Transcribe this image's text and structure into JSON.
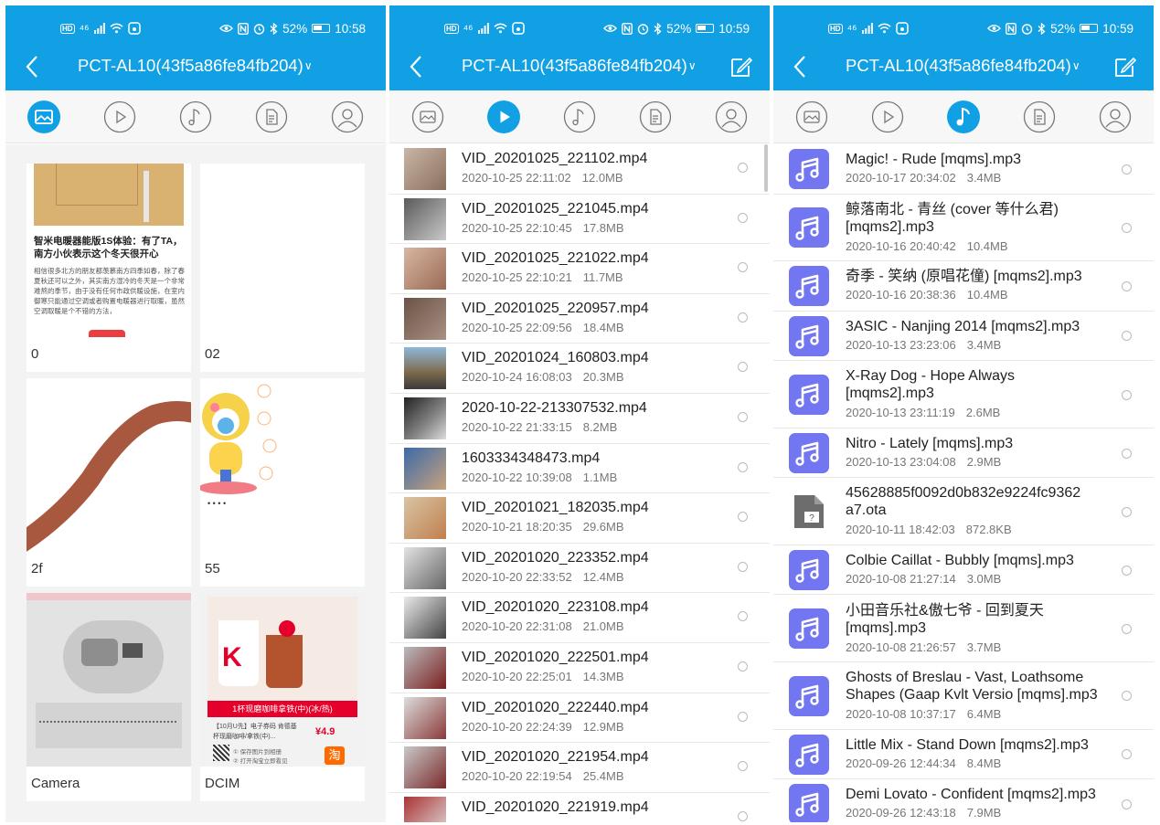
{
  "status_bars": [
    {
      "hd": "HD",
      "net": "⁴⁶",
      "battery": "52%",
      "time": "10:58"
    },
    {
      "hd": "HD",
      "net": "⁴⁶",
      "battery": "52%",
      "time": "10:59"
    },
    {
      "hd": "HD",
      "net": "⁴⁶",
      "battery": "52%",
      "time": "10:59"
    }
  ],
  "device_title": "PCT-AL10(43f5a86fe84fb204)",
  "tab_icons": [
    "picture-icon",
    "video-play-icon",
    "music-note-icon",
    "document-icon",
    "contact-person-icon"
  ],
  "accent_color": "#10a0e3",
  "music_icon_color": "#7276f0",
  "screen1": {
    "folders": [
      {
        "label": "0",
        "article_title": "智米电暖器能版1S体验：有了TA，南方小伙表示这个冬天很开心",
        "article_body": "相信很多北方的朋友都羡慕南方四季如春，除了春夏秋还可以之外，其实南方湿冷的冬天是一个非常难熬的季节，由于没有任何市政供暖设施，在室内御寒只能通过空调或者购置电暖器进行取暖，虽然空调取暖是个不错的方法，"
      },
      {
        "label": "02"
      },
      {
        "label": "2f"
      },
      {
        "label": "55"
      },
      {
        "label": "Camera"
      },
      {
        "label": "DCIM",
        "ad_headline": "1杯现磨咖啡拿铁(中)(冰/热)",
        "ad_price": "¥4.9",
        "ad_desc": "【10月U先】电子券码 肯德基 杯现磨咖啡/拿铁(中)...",
        "ad_step1": "① 保存图片到相册",
        "ad_step2": "② 打开淘宝立即看见",
        "ad_taobao": "淘",
        "ad_k": "K"
      }
    ]
  },
  "screen2": {
    "videos": [
      {
        "name": "VID_20201025_221102.mp4",
        "date": "2020-10-25 22:11:02",
        "size": "12.0MB"
      },
      {
        "name": "VID_20201025_221045.mp4",
        "date": "2020-10-25 22:10:45",
        "size": "17.8MB"
      },
      {
        "name": "VID_20201025_221022.mp4",
        "date": "2020-10-25 22:10:21",
        "size": "11.7MB"
      },
      {
        "name": "VID_20201025_220957.mp4",
        "date": "2020-10-25 22:09:56",
        "size": "18.4MB"
      },
      {
        "name": "VID_20201024_160803.mp4",
        "date": "2020-10-24 16:08:03",
        "size": "20.3MB"
      },
      {
        "name": "2020-10-22-213307532.mp4",
        "date": "2020-10-22 21:33:15",
        "size": "8.2MB"
      },
      {
        "name": "1603334348473.mp4",
        "date": "2020-10-22 10:39:08",
        "size": "1.1MB"
      },
      {
        "name": "VID_20201021_182035.mp4",
        "date": "2020-10-21 18:20:35",
        "size": "29.6MB"
      },
      {
        "name": "VID_20201020_223352.mp4",
        "date": "2020-10-20 22:33:52",
        "size": "12.4MB"
      },
      {
        "name": "VID_20201020_223108.mp4",
        "date": "2020-10-20 22:31:08",
        "size": "21.0MB"
      },
      {
        "name": "VID_20201020_222501.mp4",
        "date": "2020-10-20 22:25:01",
        "size": "14.3MB"
      },
      {
        "name": "VID_20201020_222440.mp4",
        "date": "2020-10-20 22:24:39",
        "size": "12.9MB"
      },
      {
        "name": "VID_20201020_221954.mp4",
        "date": "2020-10-20 22:19:54",
        "size": "25.4MB"
      },
      {
        "name": "VID_20201020_221919.mp4",
        "date": "",
        "size": ""
      }
    ]
  },
  "screen3": {
    "files": [
      {
        "l1": "Magic! - Rude [mqms].mp3",
        "l2": "",
        "date": "2020-10-17 20:34:02",
        "size": "3.4MB",
        "icon": "music"
      },
      {
        "l1": "鲸落南北 - 青丝 (cover 等什么君)",
        "l2": "[mqms2].mp3",
        "date": "2020-10-16 20:40:42",
        "size": "10.4MB",
        "icon": "music"
      },
      {
        "l1": "奇季 - 笑纳 (原唱花僮) [mqms2].mp3",
        "l2": "",
        "date": "2020-10-16 20:38:36",
        "size": "10.4MB",
        "icon": "music"
      },
      {
        "l1": "3ASIC - Nanjing 2014 [mqms2].mp3",
        "l2": "",
        "date": "2020-10-13 23:23:06",
        "size": "3.4MB",
        "icon": "music"
      },
      {
        "l1": "X-Ray Dog - Hope Always",
        "l2": "[mqms2].mp3",
        "date": "2020-10-13 23:11:19",
        "size": "2.6MB",
        "icon": "music"
      },
      {
        "l1": "Nitro - Lately [mqms].mp3",
        "l2": "",
        "date": "2020-10-13 23:04:08",
        "size": "2.9MB",
        "icon": "music"
      },
      {
        "l1": "45628885f0092d0b832e9224fc9362",
        "l2": "a7.ota",
        "date": "2020-10-11 18:42:03",
        "size": "872.8KB",
        "icon": "unknown"
      },
      {
        "l1": "Colbie Caillat - Bubbly [mqms].mp3",
        "l2": "",
        "date": "2020-10-08 21:27:14",
        "size": "3.0MB",
        "icon": "music"
      },
      {
        "l1": "小田音乐社&傲七爷 - 回到夏天",
        "l2": "[mqms].mp3",
        "date": "2020-10-08 21:26:57",
        "size": "3.7MB",
        "icon": "music"
      },
      {
        "l1": "Ghosts of Breslau - Vast, Loathsome",
        "l2": "Shapes (Gaap Kvlt Versio [mqms].mp3",
        "date": "2020-10-08 10:37:17",
        "size": "6.4MB",
        "icon": "music"
      },
      {
        "l1": "Little Mix - Stand Down [mqms2].mp3",
        "l2": "",
        "date": "2020-09-26 12:44:34",
        "size": "8.4MB",
        "icon": "music"
      },
      {
        "l1": "Demi Lovato - Confident [mqms2].mp3",
        "l2": "",
        "date": "2020-09-26 12:43:18",
        "size": "7.9MB",
        "icon": "music"
      }
    ]
  }
}
